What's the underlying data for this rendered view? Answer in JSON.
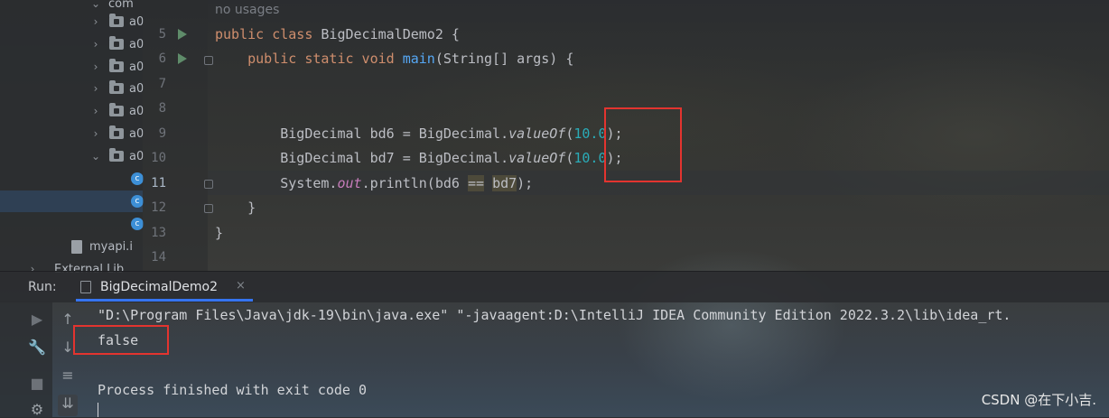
{
  "project_tree": {
    "top_item": "com",
    "folders": [
      "a0",
      "a0",
      "a0",
      "a0",
      "a0",
      "a0",
      "a0"
    ],
    "config_file": "myapi.i",
    "external_libs": "External Lib"
  },
  "editor": {
    "hint": "no usages",
    "line_numbers": [
      "5",
      "6",
      "7",
      "8",
      "9",
      "10",
      "11",
      "12",
      "13",
      "14"
    ],
    "code": {
      "class_kw": "public class",
      "class_name": "BigDecimalDemo2",
      "class_brace": " {",
      "method_kw": "public static void",
      "method_name": "main",
      "method_params": "(String[] args) {",
      "bd6_pre": "BigDecimal bd6 = BigDecimal.",
      "value_of": "valueOf",
      "open_paren": "(",
      "number": "10.0",
      "close": ");",
      "bd7_pre": "BigDecimal bd7 = BigDecimal.",
      "sys": "System.",
      "out": "out",
      "println": ".println(bd6 ",
      "eq": "==",
      "bd7_arg": "bd7",
      "println_end": ");",
      "close_brace": "}"
    }
  },
  "run_panel": {
    "label": "Run:",
    "tab_label": "BigDecimalDemo2",
    "tab_close": "×",
    "command_line": "\"D:\\Program Files\\Java\\jdk-19\\bin\\java.exe\" \"-javaagent:D:\\IntelliJ IDEA Community Edition 2022.3.2\\lib\\idea_rt.",
    "output": "false",
    "exit_message": "Process finished with exit code 0"
  },
  "watermark": "CSDN @在下小吉.",
  "colors": {
    "annotation_red": "#e3342f",
    "keyword": "#cf8e6d",
    "method": "#56a8f5",
    "number": "#2aacb8"
  }
}
